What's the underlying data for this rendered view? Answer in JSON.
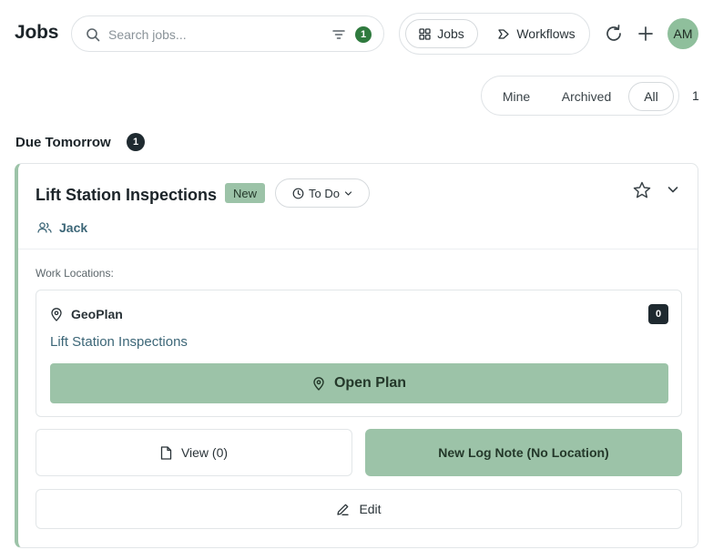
{
  "header": {
    "title": "Jobs",
    "search": {
      "placeholder": "Search jobs...",
      "value": "",
      "filter_count": "1"
    },
    "view_switch": {
      "jobs_label": "Jobs",
      "workflows_label": "Workflows",
      "active": "Jobs"
    },
    "avatar_initials": "AM",
    "icons": [
      "search-icon",
      "filter-icon",
      "grid-icon",
      "workflow-icon",
      "refresh-icon",
      "plus-icon"
    ]
  },
  "filters": {
    "options": [
      "Mine",
      "Archived",
      "All"
    ],
    "selected": "All",
    "count": "1"
  },
  "section": {
    "title": "Due Tomorrow",
    "count": "1"
  },
  "job": {
    "title": "Lift Station Inspections",
    "tag": "New",
    "status": "To Do",
    "assignee": "Jack",
    "work_locations_label": "Work Locations:",
    "location": {
      "name": "GeoPlan",
      "count": "0",
      "link": "Lift Station Inspections",
      "open_plan_label": "Open Plan"
    },
    "actions": {
      "view_label": "View (0)",
      "log_note_label": "New Log Note (No Location)",
      "edit_label": "Edit"
    }
  },
  "colors": {
    "accent_green": "#9cc3a8",
    "badge_green": "#2f7a3e",
    "dark_badge": "#1f2a30",
    "link_blue": "#3c6677"
  }
}
